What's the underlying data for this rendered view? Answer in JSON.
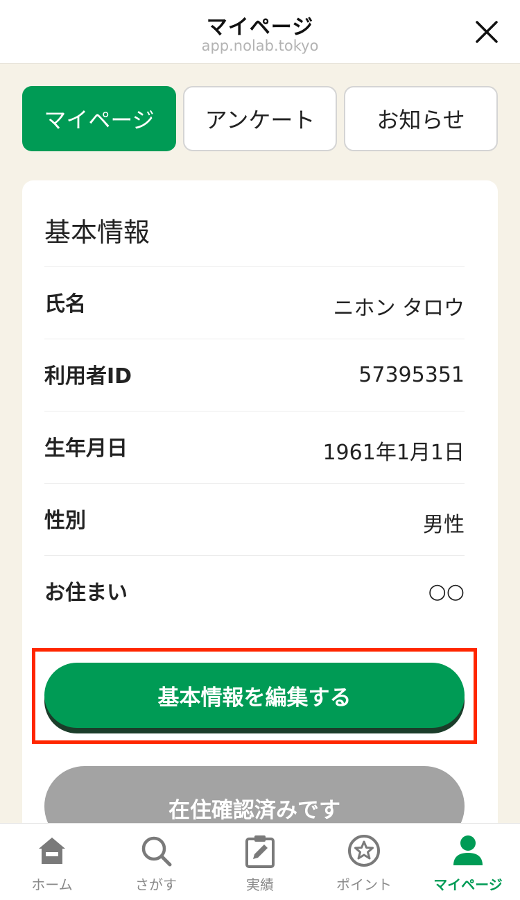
{
  "header": {
    "title": "マイページ",
    "url": "app.nolab.tokyo"
  },
  "tabs": [
    {
      "label": "マイページ",
      "active": true
    },
    {
      "label": "アンケート",
      "active": false
    },
    {
      "label": "お知らせ",
      "active": false
    }
  ],
  "basic_info": {
    "heading": "基本情報",
    "rows": [
      {
        "label": "氏名",
        "value": "ニホン タロウ"
      },
      {
        "label": "利用者ID",
        "value": "57395351"
      },
      {
        "label": "生年月日",
        "value": "1961年1月1日"
      },
      {
        "label": "性別",
        "value": "男性"
      },
      {
        "label": "お住まい",
        "value": "○○"
      }
    ],
    "edit_button": "基本情報を編集する",
    "verified_button": "在住確認済みです"
  },
  "bottom_nav": [
    {
      "label": "ホーム",
      "icon": "home-icon"
    },
    {
      "label": "さがす",
      "icon": "search-icon"
    },
    {
      "label": "実績",
      "icon": "clipboard-edit-icon"
    },
    {
      "label": "ポイント",
      "icon": "star-badge-icon"
    },
    {
      "label": "マイページ",
      "icon": "person-icon",
      "active": true
    }
  ],
  "colors": {
    "brand_green": "#009b55",
    "highlight_red": "#ff2600",
    "background": "#f6f2e7",
    "disabled_gray": "#a3a3a3"
  }
}
